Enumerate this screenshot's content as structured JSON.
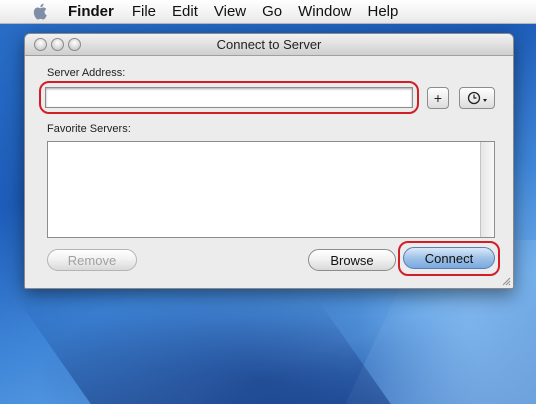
{
  "menubar": {
    "app_name": "Finder",
    "items": [
      "File",
      "Edit",
      "View",
      "Go",
      "Window",
      "Help"
    ]
  },
  "window": {
    "title": "Connect to Server",
    "server_address_label": "Server Address:",
    "server_address_value": "",
    "add_button_label": "+",
    "favorites_label": "Favorite Servers:",
    "remove_button_label": "Remove",
    "browse_button_label": "Browse",
    "connect_button_label": "Connect"
  },
  "icons": {
    "apple": "apple-logo-icon",
    "history": "clock-history-icon",
    "resize": "resize-grip-icon"
  },
  "colors": {
    "highlight": "#d21f27",
    "default_button": "#7aa9e0",
    "desktop": "#2a6fc8"
  }
}
